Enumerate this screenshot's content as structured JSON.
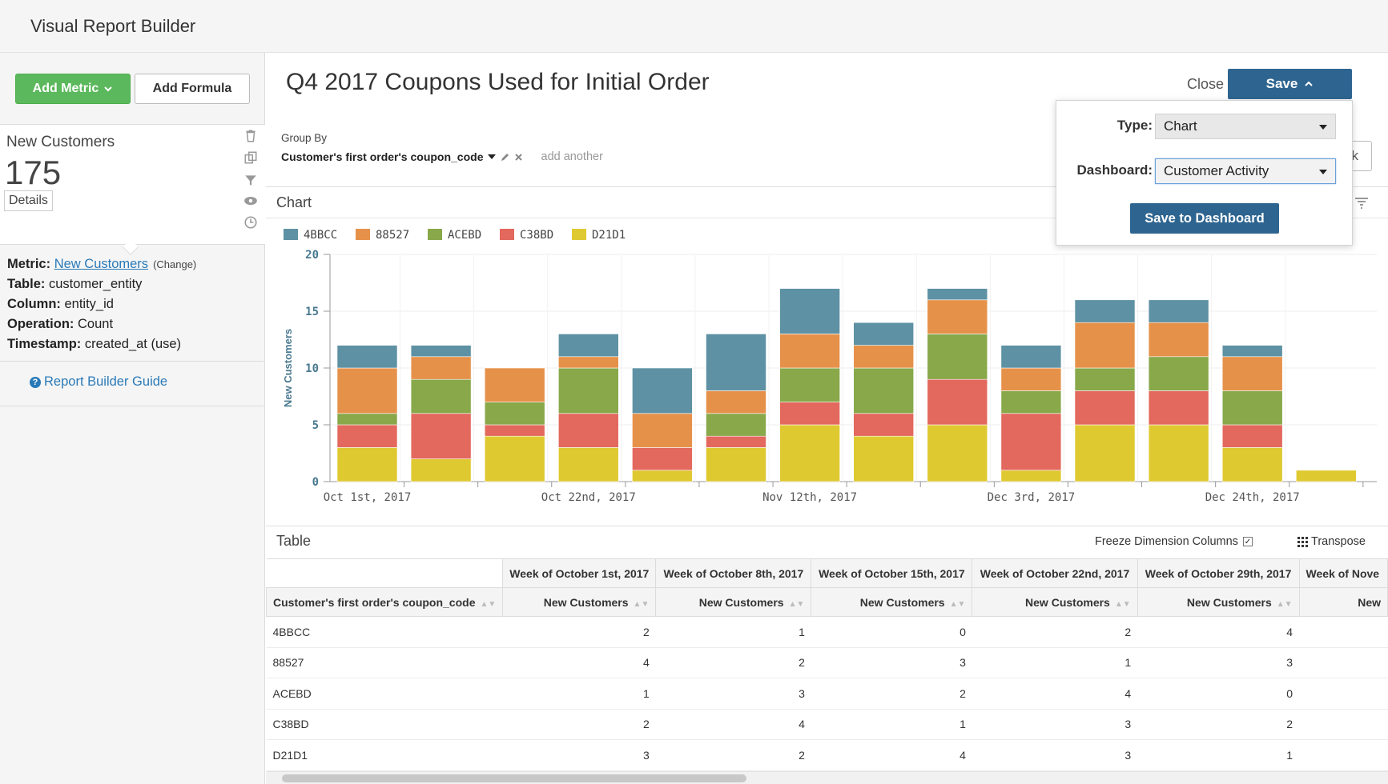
{
  "app": {
    "title": "Visual Report Builder"
  },
  "left": {
    "add_metric_label": "Add Metric",
    "add_formula_label": "Add Formula",
    "metric_card": {
      "name": "New Customers",
      "value": "175",
      "details_label": "Details"
    },
    "meta": {
      "metric_label": "Metric:",
      "metric_value": "New Customers",
      "change_label": "(Change)",
      "table_label": "Table:",
      "table_value": "customer_entity",
      "column_label": "Column:",
      "column_value": "entity_id",
      "operation_label": "Operation:",
      "operation_value": "Count",
      "timestamp_label": "Timestamp:",
      "timestamp_value": "created_at (use)"
    },
    "guide_label": "Report Builder Guide"
  },
  "header": {
    "report_title": "Q4 2017 Coupons Used for Initial Order",
    "close_label": "Close",
    "save_label": "Save"
  },
  "groupby": {
    "label": "Group By",
    "value": "Customer's first order's coupon_code",
    "add_label": "add another"
  },
  "popover": {
    "type_label": "Type:",
    "type_value": "Chart",
    "dashboard_label": "Dashboard:",
    "dashboard_value": "Customer Activity",
    "save_button": "Save to Dashboard",
    "peek_text": "ek"
  },
  "chart_section": {
    "title": "Chart"
  },
  "table_section": {
    "title": "Table",
    "freeze_label": "Freeze Dimension Columns",
    "transpose_label": "Transpose"
  },
  "colors": {
    "4BBCC": "#5e91a3",
    "88527": "#e6914a",
    "ACEBD": "#88a84a",
    "C38BD": "#e3685e",
    "D21D1": "#dfc931"
  },
  "chart_data": {
    "type": "bar",
    "stacked": true,
    "ylabel": "New Customers",
    "ylim": [
      0,
      20
    ],
    "yticks": [
      0,
      5,
      10,
      15,
      20
    ],
    "x_tick_labels": [
      "Oct 1st, 2017",
      "Oct 22nd, 2017",
      "Nov 12th, 2017",
      "Dec 3rd, 2017",
      "Dec 24th, 2017"
    ],
    "x_tick_indices": [
      0,
      3,
      6,
      9,
      12
    ],
    "categories": [
      "Oct 1",
      "Oct 8",
      "Oct 15",
      "Oct 22",
      "Oct 29",
      "Nov 5",
      "Nov 12",
      "Nov 19",
      "Nov 26",
      "Dec 3",
      "Dec 10",
      "Dec 17",
      "Dec 24",
      "Dec 31"
    ],
    "legend": [
      "4BBCC",
      "88527",
      "ACEBD",
      "C38BD",
      "D21D1"
    ],
    "series": [
      {
        "name": "D21D1",
        "values": [
          3,
          2,
          4,
          3,
          1,
          3,
          5,
          4,
          5,
          1,
          5,
          5,
          3,
          1
        ]
      },
      {
        "name": "C38BD",
        "values": [
          2,
          4,
          1,
          3,
          2,
          1,
          2,
          2,
          4,
          5,
          3,
          3,
          2,
          0
        ]
      },
      {
        "name": "ACEBD",
        "values": [
          1,
          3,
          2,
          4,
          0,
          2,
          3,
          4,
          4,
          2,
          2,
          3,
          3,
          0
        ]
      },
      {
        "name": "88527",
        "values": [
          4,
          2,
          3,
          1,
          3,
          2,
          3,
          2,
          3,
          2,
          4,
          3,
          3,
          0
        ]
      },
      {
        "name": "4BBCC",
        "values": [
          2,
          1,
          0,
          2,
          4,
          5,
          4,
          2,
          1,
          2,
          2,
          2,
          1,
          0
        ]
      }
    ]
  },
  "table": {
    "week_headers": [
      "Week of October 1st, 2017",
      "Week of October 8th, 2017",
      "Week of October 15th, 2017",
      "Week of October 22nd, 2017",
      "Week of October 29th, 2017",
      "Week of Nove"
    ],
    "dimension_header": "Customer's first order's coupon_code",
    "metric_header": "New Customers",
    "metric_header_cut": "New",
    "rows": [
      {
        "code": "4BBCC",
        "v": [
          "2",
          "1",
          "0",
          "2",
          "4"
        ]
      },
      {
        "code": "88527",
        "v": [
          "4",
          "2",
          "3",
          "1",
          "3"
        ]
      },
      {
        "code": "ACEBD",
        "v": [
          "1",
          "3",
          "2",
          "4",
          "0"
        ]
      },
      {
        "code": "C38BD",
        "v": [
          "2",
          "4",
          "1",
          "3",
          "2"
        ]
      },
      {
        "code": "D21D1",
        "v": [
          "3",
          "2",
          "4",
          "3",
          "1"
        ]
      }
    ]
  }
}
